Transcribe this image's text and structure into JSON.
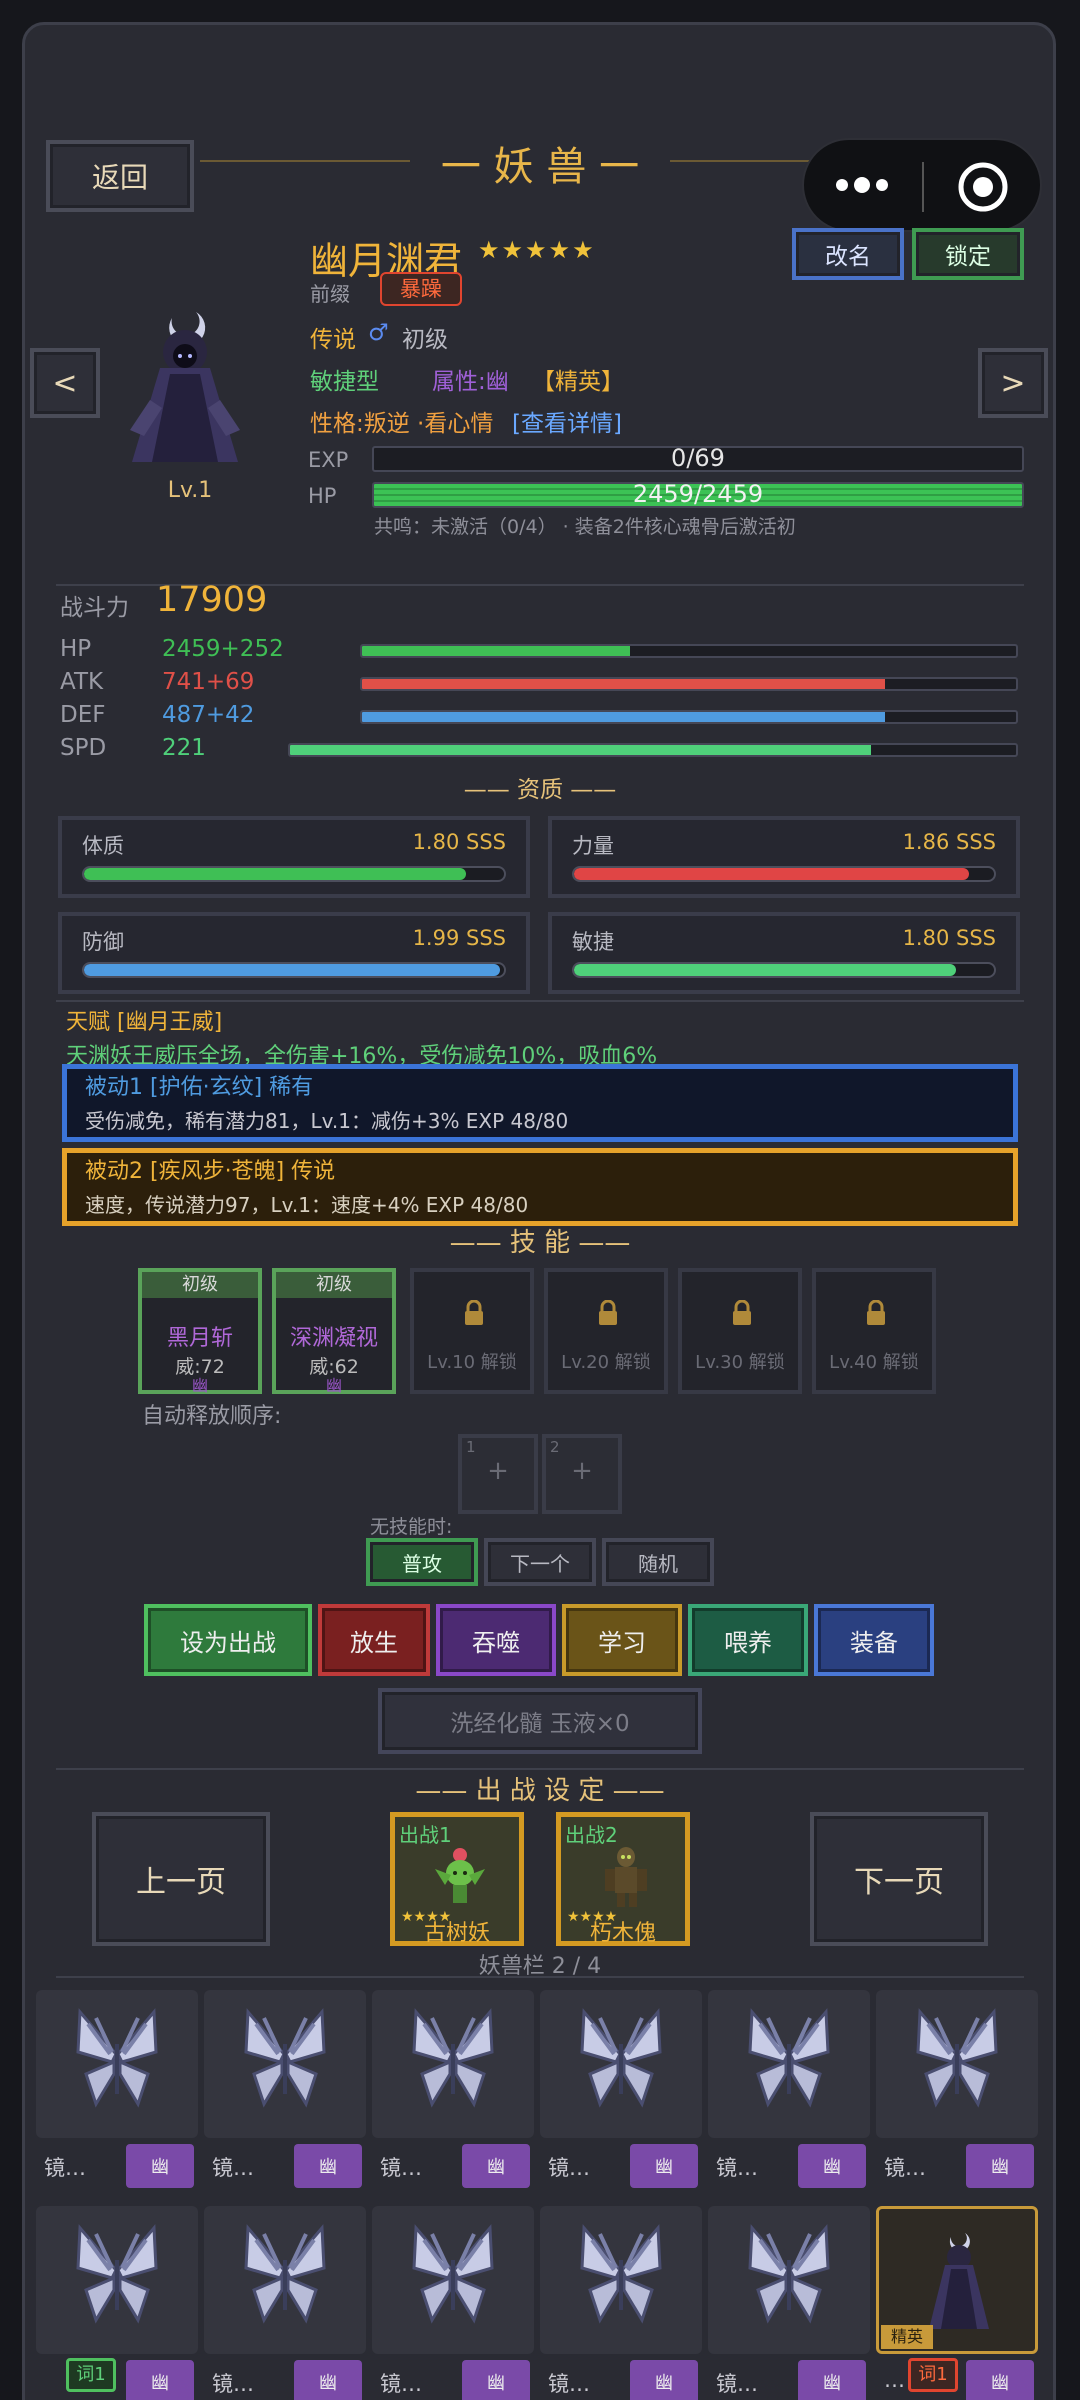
{
  "header": {
    "back_label": "返回",
    "title": "一 妖 兽 一"
  },
  "capsule": {
    "more_icon": "more-dots-icon",
    "close_icon": "target-icon"
  },
  "monster": {
    "name": "幽月渊君",
    "stars": "★★★★★",
    "prefix_label": "前缀",
    "prefix_tag": "暴躁",
    "rank": "传说",
    "gender_symbol": "♂",
    "stage": "初级",
    "type": "敏捷型",
    "attribute": "属性:幽",
    "elite_tag": "【精英】",
    "personality": "性格:叛逆 ·看心情",
    "details_link": "[查看详情]",
    "level": "Lv.1",
    "exp_label": "EXP",
    "exp_text": "0/69",
    "exp_fraction": 0,
    "hp_label": "HP",
    "hp_text": "2459/2459",
    "hp_fraction": 1,
    "resonance": "共鸣：未激活（0/4） · 装备2件核心魂骨后激活初"
  },
  "buttons": {
    "rename": "改名",
    "lock": "锁定",
    "prev_arrow": "<",
    "next_arrow": ">"
  },
  "power": {
    "label": "战斗力",
    "value": "17909"
  },
  "stats": [
    {
      "label": "HP",
      "value": "2459+252",
      "fill": 0.41,
      "color": "#3fbf55"
    },
    {
      "label": "ATK",
      "value": "741+69",
      "fill": 0.8,
      "color": "#e05048"
    },
    {
      "label": "DEF",
      "value": "487+42",
      "fill": 0.8,
      "color": "#4f9be0"
    },
    {
      "label": "SPD",
      "value": "221",
      "fill": 0.8,
      "color": "#4fd07a"
    }
  ],
  "aptitude": {
    "title": "—— 资质 ——",
    "items": [
      {
        "name": "体质",
        "value": "1.80 SSS",
        "fill": 0.91,
        "color": "#3fbf55"
      },
      {
        "name": "力量",
        "value": "1.86 SSS",
        "fill": 0.94,
        "color": "#e04545"
      },
      {
        "name": "防御",
        "value": "1.99 SSS",
        "fill": 0.99,
        "color": "#4f9be0"
      },
      {
        "name": "敏捷",
        "value": "1.80 SSS",
        "fill": 0.91,
        "color": "#4fd07a"
      }
    ]
  },
  "talent": {
    "title": "天赋 [幽月王威]",
    "desc": "天渊妖王威压全场，全伤害+16%，受伤减免10%，吸血6%"
  },
  "passives": [
    {
      "title": "被动1 [护佑·玄纹] 稀有",
      "desc": "受伤减免，稀有潜力81，Lv.1：减伤+3%  EXP 48/80"
    },
    {
      "title": "被动2 [疾风步·苍魄] 传说",
      "desc": "速度，传说潜力97，Lv.1：速度+4%  EXP 48/80"
    }
  ],
  "skills": {
    "title": "—— 技 能 ——",
    "learned": [
      {
        "grade": "初级",
        "name": "黑月斩",
        "power": "威:72",
        "element": "幽"
      },
      {
        "grade": "初级",
        "name": "深渊凝视",
        "power": "威:62",
        "element": "幽"
      }
    ],
    "locked": [
      "Lv.10 解锁",
      "Lv.20 解锁",
      "Lv.30 解锁",
      "Lv.40 解锁"
    ],
    "auto_order_label": "自动释放顺序:",
    "slots": [
      {
        "num": "1",
        "plus": "+"
      },
      {
        "num": "2",
        "plus": "+"
      }
    ],
    "no_skill_label": "无技能时:",
    "no_skill_options": [
      "普攻",
      "下一个",
      "随机"
    ]
  },
  "actions": [
    "设为出战",
    "放生",
    "吞噬",
    "学习",
    "喂养",
    "装备"
  ],
  "refine": "洗经化髓  玉液×0",
  "battle": {
    "title": "—— 出 战 设 定 ——",
    "prev_page": "上一页",
    "next_page": "下一页",
    "slots": [
      {
        "tag": "出战1",
        "stars": "★★★★",
        "name": "古树妖"
      },
      {
        "tag": "出战2",
        "stars": "★★★★",
        "name": "朽木傀"
      }
    ],
    "roster": "妖兽栏 2 / 4"
  },
  "grid": {
    "name": "镜…",
    "badge": "幽",
    "word_tag": "词1",
    "elite_tag": "精英",
    "last_name": "…"
  }
}
